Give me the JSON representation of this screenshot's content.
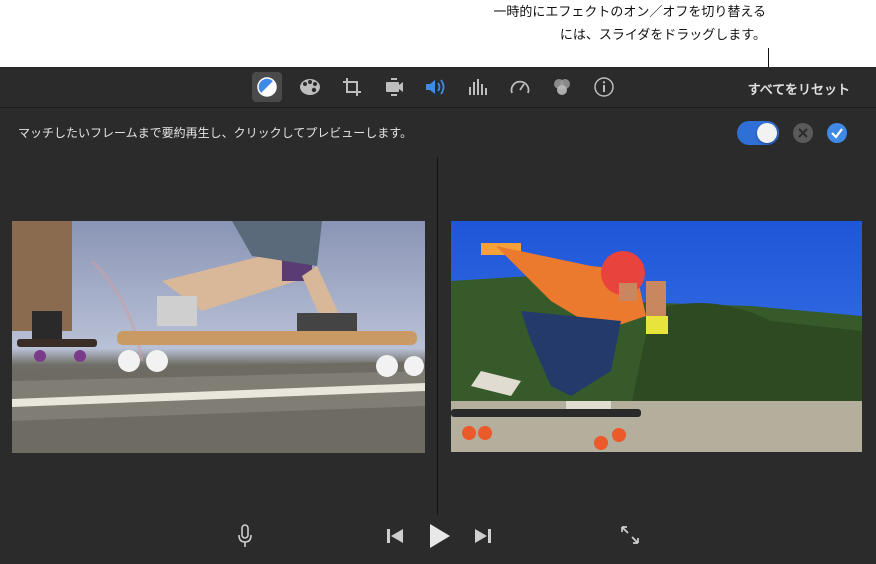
{
  "callout": {
    "line1": "一時的にエフェクトのオン／オフを切り替える",
    "line2": "には、スライダをドラッグします。"
  },
  "toolbar": {
    "tools": [
      {
        "name": "color-balance-icon",
        "active": true
      },
      {
        "name": "color-correction-icon",
        "active": false
      },
      {
        "name": "crop-icon",
        "active": false
      },
      {
        "name": "stabilization-icon",
        "active": false
      },
      {
        "name": "volume-icon",
        "active": false
      },
      {
        "name": "noise-reduction-equalizer-icon",
        "active": false
      },
      {
        "name": "speed-icon",
        "active": false
      },
      {
        "name": "clip-filter-icon",
        "active": false
      },
      {
        "name": "info-icon",
        "active": false
      }
    ],
    "reset_label": "すべてをリセット"
  },
  "instruction": "マッチしたいフレームまで要約再生し、クリックしてプレビューします。",
  "toggle": {
    "on": true
  },
  "colors": {
    "accent": "#2f6fd6",
    "background": "#2b2b2b",
    "text": "#e4e4e4"
  }
}
